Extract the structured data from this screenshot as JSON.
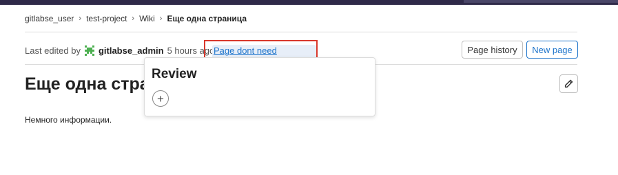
{
  "breadcrumb": {
    "items": [
      "gitlabse_user",
      "test-project",
      "Wiki",
      "Еще одна страница"
    ]
  },
  "meta": {
    "last_edited_by": "Last edited by",
    "author": "gitlabse_admin",
    "time_ago": "5 hours ago",
    "approval_link": "Page dont need approval."
  },
  "buttons": {
    "page_history": "Page history",
    "new_page": "New page"
  },
  "page": {
    "title": "Еще одна страница",
    "content": "Немного информации."
  },
  "popover": {
    "title": "Review",
    "add_symbol": "+"
  },
  "colors": {
    "accent": "#1f75cb",
    "highlight_border": "#d9382c",
    "avatar": "#4caf50",
    "topbar": "#2f2a49"
  },
  "icons": [
    "chevron-right-icon",
    "avatar-icon",
    "pencil-icon",
    "plus-icon"
  ]
}
